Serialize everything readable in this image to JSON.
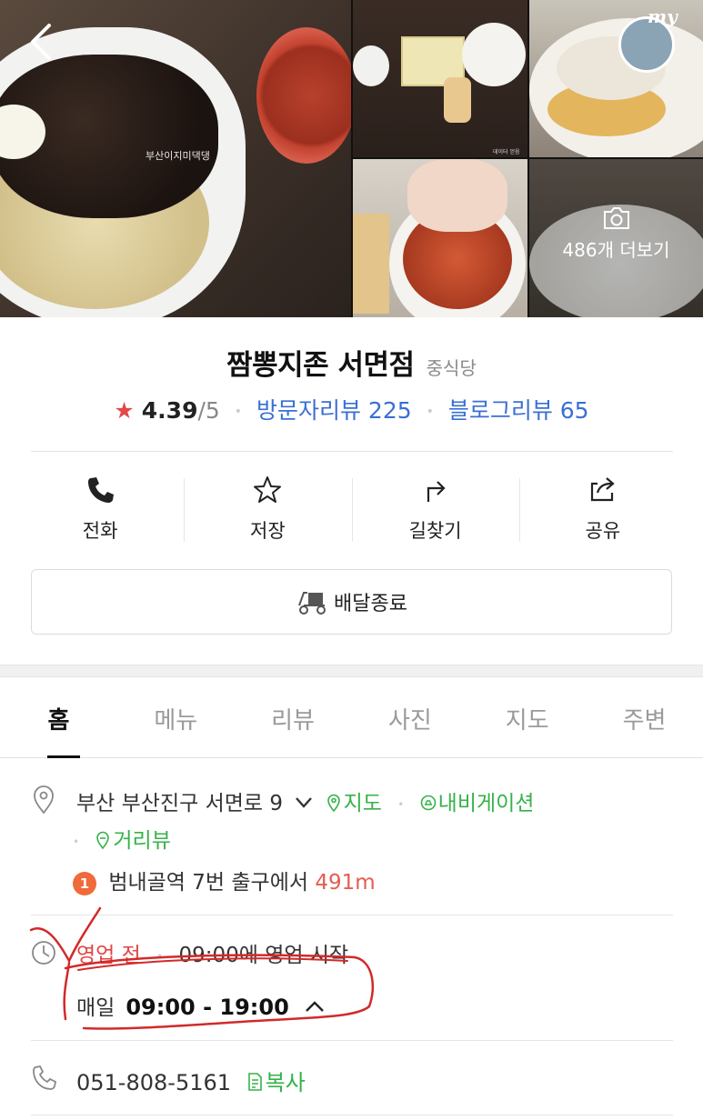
{
  "gallery": {
    "watermark": "부산이지미댁댕",
    "photo_note": "데이터 얻음",
    "more_label": "486개 더보기",
    "profile_badge": "my"
  },
  "place": {
    "name": "짬뽕지존 서면점",
    "category": "중식당",
    "rating_star": "★",
    "rating": "4.39",
    "rating_max": "/5",
    "visitor_review": "방문자리뷰 225",
    "blog_review": "블로그리뷰 65"
  },
  "actions": {
    "call": "전화",
    "save": "저장",
    "directions": "길찾기",
    "share": "공유"
  },
  "delivery_label": "배달종료",
  "tabs": [
    "홈",
    "메뉴",
    "리뷰",
    "사진",
    "지도",
    "주변"
  ],
  "info": {
    "address": "부산 부산진구 서면로 9",
    "map_link": "지도",
    "navigation_link": "내비게이션",
    "street_view_link": "거리뷰",
    "station_number": "1",
    "station_text": "범내골역 7번 출구에서",
    "station_distance": "491m",
    "status": "영업 전",
    "status_detail": "09:00에 영업 시작",
    "hours_day": "매일",
    "hours_time": "09:00 - 19:00",
    "phone": "051-808-5161",
    "copy_label": "복사"
  },
  "colors": {
    "accent_blue": "#3a6fd4",
    "accent_green": "#35b24a",
    "status_red": "#e24545",
    "star_red": "#e24949",
    "scribble_red": "#d22a2a"
  }
}
